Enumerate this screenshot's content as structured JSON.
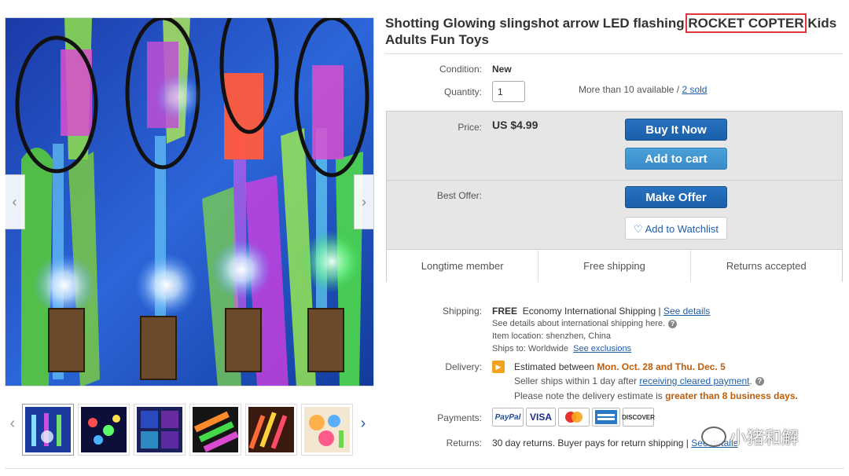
{
  "title": {
    "prefix": "Shotting Glowing slingshot arrow LED flashing ",
    "highlight": "ROCKET COPTER",
    "suffix": " Kids Adults Fun Toys"
  },
  "condition": {
    "label": "Condition:",
    "value": "New"
  },
  "quantity": {
    "label": "Quantity:",
    "value": "1",
    "available": "More than 10 available /",
    "sold_link": "2 sold"
  },
  "buybox": {
    "price_label": "Price:",
    "price": "US $4.99",
    "buy_now": "Buy It Now",
    "add_to_cart": "Add to cart",
    "offer_label": "Best Offer:",
    "make_offer": "Make Offer",
    "watchlist": "Add to Watchlist",
    "badges": [
      "Longtime member",
      "Free shipping",
      "Returns accepted"
    ]
  },
  "shipping": {
    "label": "Shipping:",
    "free": "FREE",
    "service": "Economy International Shipping |",
    "details_link": "See details",
    "intl_note": "See details about international shipping here.",
    "location": "Item location:  shenzhen, China",
    "ships_to": "Ships to:  Worldwide",
    "exclusions_link": "See exclusions"
  },
  "delivery": {
    "label": "Delivery:",
    "estimated": "Estimated between",
    "dates": "Mon. Oct. 28 and Thu. Dec. 5",
    "seller_ships": "Seller ships within 1 day after",
    "payment_link": "receiving cleared payment",
    "note": "Please note the delivery estimate is",
    "note_highlight": "greater than 8 business days."
  },
  "payments": {
    "label": "Payments:",
    "logos": [
      "PayPal",
      "VISA",
      "MasterCard",
      "AmEx",
      "DISCOVER"
    ]
  },
  "returns": {
    "label": "Returns:",
    "text": "30 day returns. Buyer pays for return shipping |",
    "link": "See details"
  },
  "watermark": "小猪和解",
  "colors": {
    "primary_button": "#1a5fa9",
    "secondary_button": "#3a8cc9",
    "highlight_box": "#e0333a",
    "orange_text": "#c05d0a",
    "link": "#1f5ea8"
  }
}
